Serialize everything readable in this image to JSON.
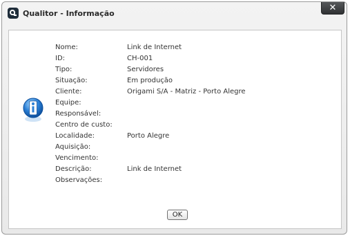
{
  "window": {
    "title": "Qualitor - Informação"
  },
  "titlebar": {
    "close_label": "✕"
  },
  "fields": [
    {
      "label": "Nome:",
      "value": "Link de Internet"
    },
    {
      "label": "ID:",
      "value": "CH-001"
    },
    {
      "label": "Tipo:",
      "value": "Servidores"
    },
    {
      "label": "Situação:",
      "value": "Em produção"
    },
    {
      "label": "Cliente:",
      "value": "Origami S/A - Matriz - Porto Alegre"
    },
    {
      "label": "Equipe:",
      "value": ""
    },
    {
      "label": "Responsável:",
      "value": ""
    },
    {
      "label": "Centro de custo:",
      "value": ""
    },
    {
      "label": "Localidade:",
      "value": "Porto Alegre"
    },
    {
      "label": "Aquisição:",
      "value": ""
    },
    {
      "label": "Vencimento:",
      "value": ""
    },
    {
      "label": "Descrição:",
      "value": "Link de Internet"
    },
    {
      "label": "Observações:",
      "value": ""
    }
  ],
  "buttons": {
    "ok_label": "OK"
  },
  "icons": {
    "app": "qualitor-logo-icon",
    "info": "info-icon",
    "close": "close-icon"
  },
  "colors": {
    "window_bg": "#eeeeee",
    "close_button": "#3c3e40",
    "info_icon_blue": "#2b7fd6"
  }
}
